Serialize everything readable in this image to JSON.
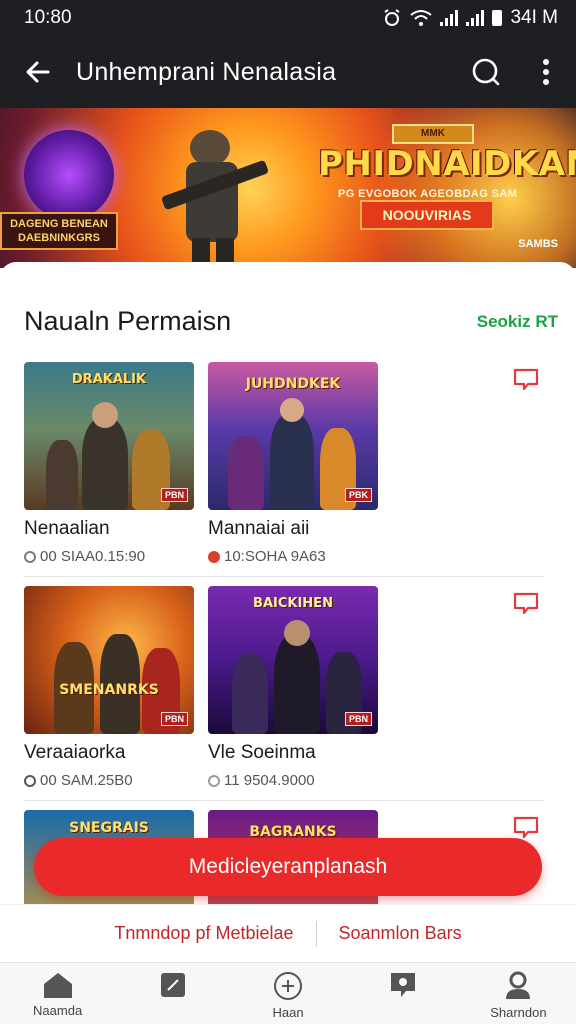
{
  "status_bar": {
    "time": "10:80",
    "battery": "34I M"
  },
  "app_bar": {
    "title": "Unhemprani Nenalasia"
  },
  "banner": {
    "badge": "MMK",
    "title": "PHIDNAIDKAN",
    "subtitle": "PG EVGOBOK AGEOBDAG SAM",
    "button_label": "NOOUVIRIAS",
    "left_label": "DAGENG BENEAN DAEBNINKGRS",
    "corner_label": "SAMBS"
  },
  "section": {
    "title": "Naualn Permaisn",
    "link": "Seokiz RT"
  },
  "games": [
    {
      "thumb_title": "DRAKALIK",
      "tag": "PBN",
      "name": "Nenaalian",
      "meta": "00 SIAA0.15:90",
      "dot_color": "#7a7a7a"
    },
    {
      "thumb_title": "JUHDNDKEK",
      "tag": "PBK",
      "name": "Mannaiai aii",
      "meta": "10:SOHA 9A63",
      "dot_color": "#d8402a"
    },
    {
      "thumb_title": "SMENANRKS",
      "tag": "PBN",
      "name": "Veraaiaorka",
      "meta": "00 SAM.25B0",
      "dot_color": "#2a9a3a"
    },
    {
      "thumb_title": "BAICKIHEN",
      "tag": "PBN",
      "name": "Vle Soeinma",
      "meta": "11 9504.9000",
      "dot_color": "#9a9a9a"
    },
    {
      "thumb_title": "SNEGRAIS",
      "tag": "",
      "name": "",
      "meta": "",
      "dot_color": "#9a9a9a"
    },
    {
      "thumb_title": "BAGRANKS",
      "tag": "",
      "name": "",
      "meta": "",
      "dot_color": "#9a9a9a"
    }
  ],
  "fab": {
    "label": "Medicleyeranplanash"
  },
  "footer_links": [
    "Tnmndop pf Metbielae",
    "Soanmlon Bars"
  ],
  "bottom_nav": [
    {
      "label": "Naamda",
      "icon": "home-icon"
    },
    {
      "label": "",
      "icon": "tablet-icon"
    },
    {
      "label": "Haan",
      "icon": "add-circle-icon"
    },
    {
      "label": "",
      "icon": "chat-icon"
    },
    {
      "label": "Sharndon",
      "icon": "profile-icon"
    }
  ],
  "colors": {
    "accent": "#ea2a2a",
    "link_green": "#1aa244",
    "appbar": "#1e1f22"
  }
}
